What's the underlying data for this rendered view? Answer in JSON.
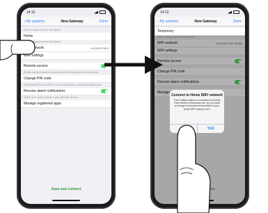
{
  "left_phone": {
    "status_time": "14:12",
    "back_label": "My systems",
    "title": "New Gateway",
    "done_label": "Done",
    "hint_top": "Enter a unique name for this System",
    "name_value": "Home",
    "name_hint": "Enter a unique name for this System",
    "wifi_network_label": "WiFi network",
    "wifi_network_value": "Access Point",
    "wifi_settings_label": "WiFi settings",
    "remote_access_label": "Remote access",
    "remote_access_hint": "Enable remote access to securely connect to this system from any device.",
    "pin_label": "Change PIN code",
    "pin_hint": "The default PIN code is 0000. It is recommended to change the default code.",
    "alarm_label": "Receive alarm notifications",
    "alarm_hint": "Switch on to receive alarms of your Defender devices",
    "apps_label": "Manage registered apps",
    "save_label": "Save and connect"
  },
  "right_phone": {
    "status_time": "14:12",
    "back_label": "My systems",
    "title": "New Gateway",
    "done_label": "Done",
    "name_value": "Temporary",
    "name_hint": "Enter a unique name for this System",
    "wifi_network_label": "WiFi network",
    "wifi_network_value": "Access Point Mode",
    "wifi_settings_label": "WiFi settings",
    "remote_access_label": "Remote access",
    "pin_label": "Change PIN code",
    "alarm_label": "Receive alarm notifications",
    "apps_label": "Manage registered apps",
    "save_label": "Save and connect",
    "dialog": {
      "title": "Connect to Home WiFi network",
      "message": "The Confidor system is connected to Access Point Mode for temporary use. Do you want to change to permanent connection to your home WiFi network now?",
      "no_label": "NO",
      "yes_label": "YES"
    }
  },
  "colors": {
    "accent": "#2f7cf6",
    "toggle_on": "#4cd964",
    "save_text": "#2f9a3b",
    "phone_body": "#1b1b1d"
  }
}
